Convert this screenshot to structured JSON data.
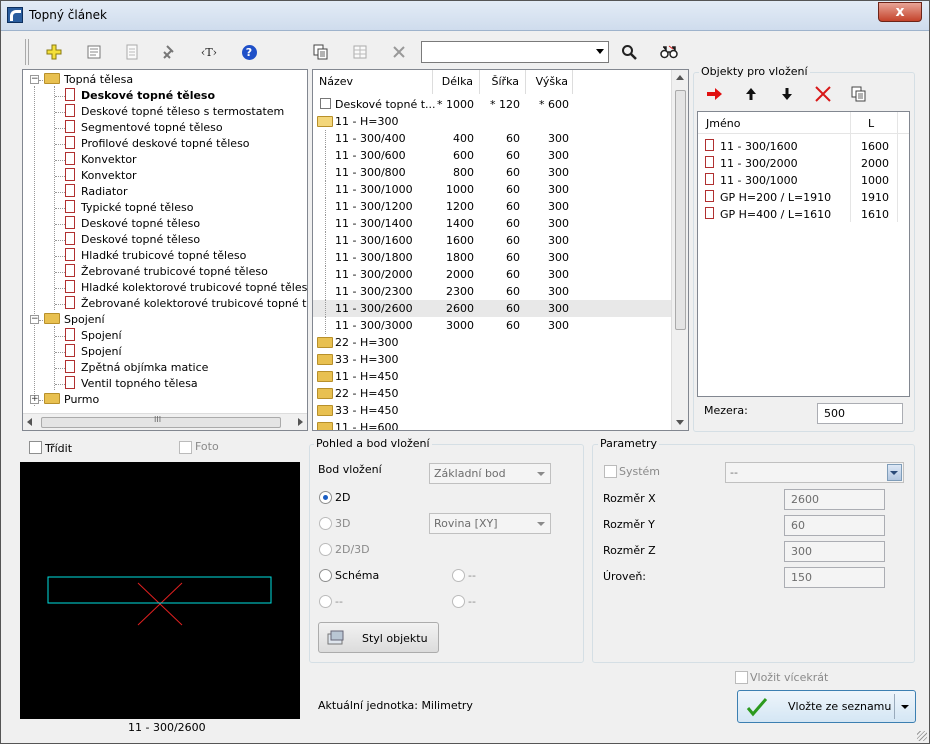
{
  "window": {
    "title": "Topný článek",
    "close_label": "x"
  },
  "toolbar": {
    "icons": [
      "plus-icon",
      "properties-icon",
      "list-icon",
      "tools-icon",
      "text-tag-icon",
      "help-icon",
      "copy-icon",
      "table-icon",
      "delete-icon",
      "search-icon",
      "binoculars-icon"
    ],
    "tag_label": "‹T›",
    "help_label": "?"
  },
  "search": {
    "value": ""
  },
  "tree": {
    "items": [
      {
        "label": "Topná tělesa",
        "type": "folder",
        "level": 0,
        "expanded": true
      },
      {
        "label": "Deskové topné těleso",
        "type": "item",
        "level": 1,
        "bold": true
      },
      {
        "label": "Deskové topné těleso s termostatem",
        "type": "item",
        "level": 1
      },
      {
        "label": "Segmentové topné těleso",
        "type": "item",
        "level": 1
      },
      {
        "label": "Profilové deskové topné těleso",
        "type": "item",
        "level": 1
      },
      {
        "label": "Konvektor",
        "type": "item",
        "level": 1
      },
      {
        "label": "Konvektor",
        "type": "item",
        "level": 1
      },
      {
        "label": "Radiator",
        "type": "item",
        "level": 1
      },
      {
        "label": "Typické topné těleso",
        "type": "item",
        "level": 1
      },
      {
        "label": "Deskové topné těleso",
        "type": "item",
        "level": 1
      },
      {
        "label": "Deskové topné těleso",
        "type": "item",
        "level": 1
      },
      {
        "label": "Hladké trubicové topné těleso",
        "type": "item",
        "level": 1
      },
      {
        "label": "Žebrované trubicové topné těleso",
        "type": "item",
        "level": 1
      },
      {
        "label": "Hladké kolektorové trubicové topné těleso",
        "type": "item",
        "level": 1
      },
      {
        "label": "Žebrované kolektorové trubicové topné těleso",
        "type": "item",
        "level": 1
      },
      {
        "label": "Spojení",
        "type": "folder",
        "level": 0,
        "expanded": true
      },
      {
        "label": "Spojení",
        "type": "item",
        "level": 1
      },
      {
        "label": "Spojení",
        "type": "item",
        "level": 1
      },
      {
        "label": "Zpětná objímka matice",
        "type": "item",
        "level": 1
      },
      {
        "label": "Ventil topného tělesa",
        "type": "item",
        "level": 1
      },
      {
        "label": "Purmo",
        "type": "folder",
        "level": 0,
        "expanded": false
      }
    ],
    "scroll_label": "III"
  },
  "list": {
    "columns": [
      "Název",
      "Délka",
      "Šířka",
      "Výška"
    ],
    "rows": [
      {
        "name": "Deskové topné t...",
        "l": "* 1000",
        "s": "* 120",
        "v": "* 600",
        "kind": "check"
      },
      {
        "name": "11 - H=300",
        "l": "",
        "s": "",
        "v": "",
        "kind": "open-folder"
      },
      {
        "name": "11 - 300/400",
        "l": "400",
        "s": "60",
        "v": "300",
        "kind": "child"
      },
      {
        "name": "11 - 300/600",
        "l": "600",
        "s": "60",
        "v": "300",
        "kind": "child"
      },
      {
        "name": "11 - 300/800",
        "l": "800",
        "s": "60",
        "v": "300",
        "kind": "child"
      },
      {
        "name": "11 - 300/1000",
        "l": "1000",
        "s": "60",
        "v": "300",
        "kind": "child"
      },
      {
        "name": "11 - 300/1200",
        "l": "1200",
        "s": "60",
        "v": "300",
        "kind": "child"
      },
      {
        "name": "11 - 300/1400",
        "l": "1400",
        "s": "60",
        "v": "300",
        "kind": "child"
      },
      {
        "name": "11 - 300/1600",
        "l": "1600",
        "s": "60",
        "v": "300",
        "kind": "child"
      },
      {
        "name": "11 - 300/1800",
        "l": "1800",
        "s": "60",
        "v": "300",
        "kind": "child"
      },
      {
        "name": "11 - 300/2000",
        "l": "2000",
        "s": "60",
        "v": "300",
        "kind": "child"
      },
      {
        "name": "11 - 300/2300",
        "l": "2300",
        "s": "60",
        "v": "300",
        "kind": "child"
      },
      {
        "name": "11 - 300/2600",
        "l": "2600",
        "s": "60",
        "v": "300",
        "kind": "child",
        "selected": true
      },
      {
        "name": "11 - 300/3000",
        "l": "3000",
        "s": "60",
        "v": "300",
        "kind": "child"
      },
      {
        "name": "22 - H=300",
        "l": "",
        "s": "",
        "v": "",
        "kind": "folder"
      },
      {
        "name": "33 - H=300",
        "l": "",
        "s": "",
        "v": "",
        "kind": "folder"
      },
      {
        "name": "11 - H=450",
        "l": "",
        "s": "",
        "v": "",
        "kind": "folder"
      },
      {
        "name": "22 - H=450",
        "l": "",
        "s": "",
        "v": "",
        "kind": "folder"
      },
      {
        "name": "33 - H=450",
        "l": "",
        "s": "",
        "v": "",
        "kind": "folder"
      },
      {
        "name": "11 - H=600",
        "l": "",
        "s": "",
        "v": "",
        "kind": "folder"
      }
    ]
  },
  "objects": {
    "title": "Objekty pro vložení",
    "tool_icons": [
      "arrow-right-icon",
      "arrow-up-icon",
      "arrow-down-icon",
      "delete-x-icon",
      "copy-icon"
    ],
    "columns": [
      "Jméno",
      "L"
    ],
    "rows": [
      {
        "name": "11 - 300/1600",
        "l": "1600"
      },
      {
        "name": "11 - 300/2000",
        "l": "2000"
      },
      {
        "name": "11 - 300/1000",
        "l": "1000"
      },
      {
        "name": "GP H=200 / L=1910",
        "l": "1910"
      },
      {
        "name": "GP H=400 / L=1610",
        "l": "1610"
      }
    ],
    "gap_label": "Mezera:",
    "gap_value": "500"
  },
  "sort": {
    "label": "Třídit",
    "checked": false
  },
  "photo": {
    "label": "Foto",
    "checked": false
  },
  "preview": {
    "caption": "11 - 300/2600",
    "rect_color": "#00e0e0",
    "cross_color": "#e02020"
  },
  "view": {
    "title": "Pohled a bod vložení",
    "insert_label": "Bod vložení",
    "insert_value": "Základní bod",
    "opt_2d": "2D",
    "opt_3d": "3D",
    "opt_2d3d": "2D/3D",
    "opt_schema": "Schéma",
    "opt_dash1": "--",
    "opt_dash2": "--",
    "opt_dash3": "--",
    "plane_value": "Rovina  [XY]",
    "style_button": "Styl objektu"
  },
  "params": {
    "title": "Parametry",
    "system_label": "Systém",
    "system_value": "--",
    "fields": [
      {
        "label": "Rozměr X",
        "value": "2600"
      },
      {
        "label": "Rozměr Y",
        "value": "60"
      },
      {
        "label": "Rozměr Z",
        "value": "300"
      },
      {
        "label": "Úroveň:",
        "value": "150"
      }
    ]
  },
  "footer": {
    "units": "Aktuální jednotka: Milimetry",
    "multi_label": "Vložit vícekrát",
    "insert_button": "Vložte ze seznamu"
  }
}
